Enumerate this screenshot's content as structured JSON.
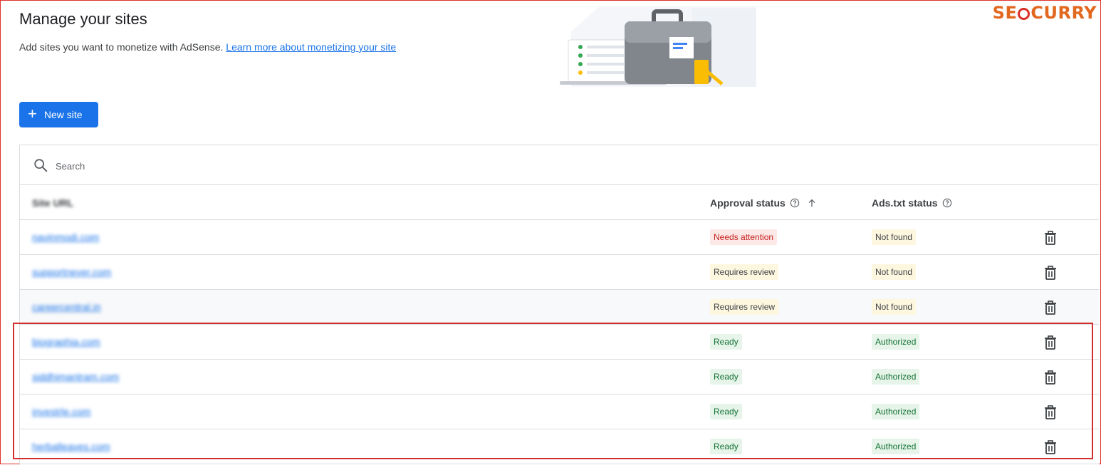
{
  "header": {
    "title": "Manage your sites",
    "subtitle": "Add sites you want to monetize with AdSense.",
    "learn_more": "Learn more about monetizing your site"
  },
  "logo": {
    "left": "SE",
    "right": "CURRY"
  },
  "actions": {
    "new_site_label": "New site"
  },
  "search": {
    "placeholder": "Search"
  },
  "table": {
    "columns": {
      "site_url": "Site URL",
      "approval": "Approval status",
      "ads_txt": "Ads.txt status"
    },
    "rows": [
      {
        "site": "navinmodi.com",
        "approval": "Needs attention",
        "approval_tone": "red",
        "ads": "Not found",
        "ads_tone": "yellow"
      },
      {
        "site": "supportnever.com",
        "approval": "Requires review",
        "approval_tone": "yellow",
        "ads": "Not found",
        "ads_tone": "yellow"
      },
      {
        "site": "careercentral.in",
        "approval": "Requires review",
        "approval_tone": "yellow",
        "ads": "Not found",
        "ads_tone": "yellow"
      },
      {
        "site": "biographia.com",
        "approval": "Ready",
        "approval_tone": "green",
        "ads": "Authorized",
        "ads_tone": "green"
      },
      {
        "site": "siddhimantram.com",
        "approval": "Ready",
        "approval_tone": "green",
        "ads": "Authorized",
        "ads_tone": "green"
      },
      {
        "site": "investrle.com",
        "approval": "Ready",
        "approval_tone": "green",
        "ads": "Authorized",
        "ads_tone": "green"
      },
      {
        "site": "herballeaves.com",
        "approval": "Ready",
        "approval_tone": "green",
        "ads": "Authorized",
        "ads_tone": "green"
      }
    ]
  },
  "colors": {
    "primary": "#1a73e8",
    "red_chip_bg": "#fce8e6",
    "yellow_chip_bg": "#fef7e0",
    "green_chip_bg": "#e6f4ea",
    "highlight_border": "#d32f2f",
    "logo_orange": "#e2671f"
  },
  "icons": {
    "add": "plus-icon",
    "search": "search-icon",
    "help": "help-circle-icon",
    "sort": "arrow-up-icon",
    "delete": "trash-icon"
  }
}
